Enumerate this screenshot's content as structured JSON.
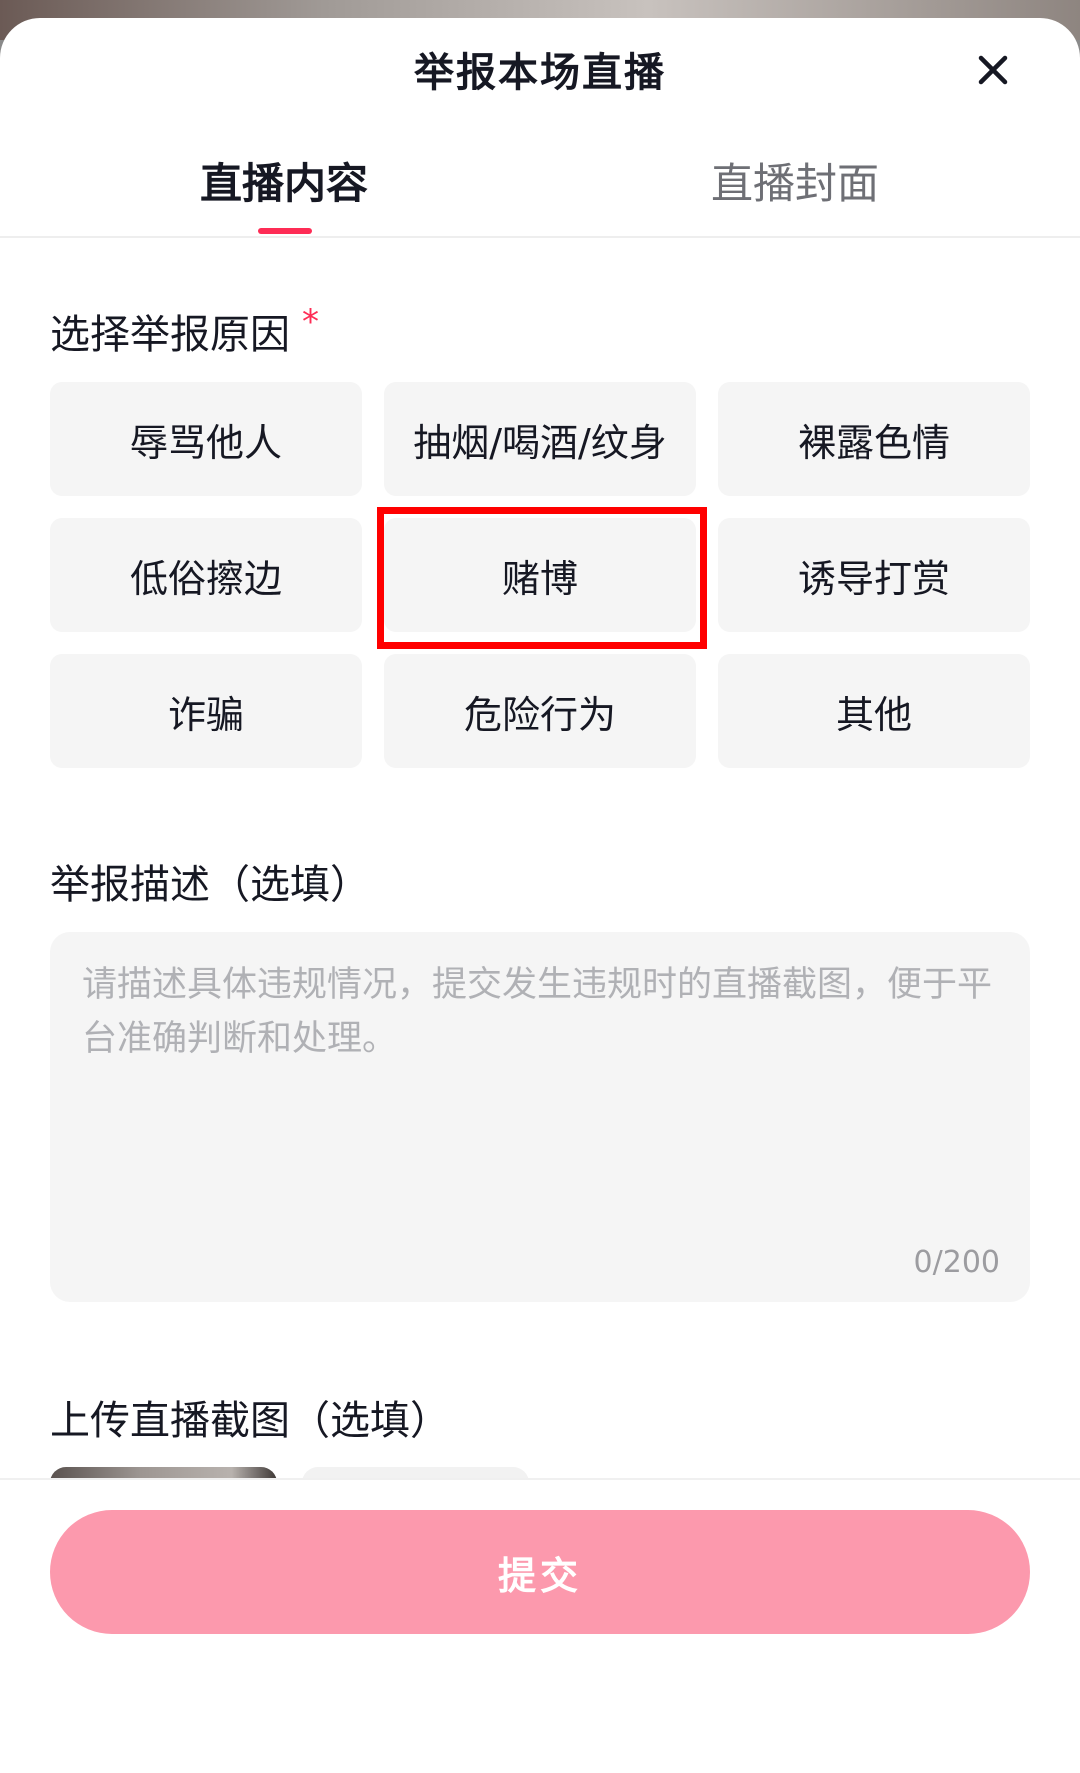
{
  "header": {
    "title": "举报本场直播",
    "close_icon": "close-icon"
  },
  "tabs": [
    {
      "label": "直播内容",
      "active": true
    },
    {
      "label": "直播封面",
      "active": false
    }
  ],
  "reason_section": {
    "label": "选择举报原因",
    "required_mark": "*",
    "reasons": [
      "辱骂他人",
      "抽烟/喝酒/纹身",
      "裸露色情",
      "低俗擦边",
      "赌博",
      "诱导打赏",
      "诈骗",
      "危险行为",
      "其他"
    ],
    "highlighted_reason": "赌博"
  },
  "description_section": {
    "label": "举报描述（选填）",
    "placeholder": "请描述具体违规情况，提交发生违规时的直播截图，便于平台准确判断和处理。",
    "counter": "0/200"
  },
  "upload_section": {
    "label": "上传直播截图（选填）"
  },
  "submit": {
    "label": "提交"
  },
  "colors": {
    "accent": "#fe2c55",
    "submit_bg": "#fc99ad",
    "highlight": "#ff0000",
    "chip_bg": "#f5f5f5"
  }
}
